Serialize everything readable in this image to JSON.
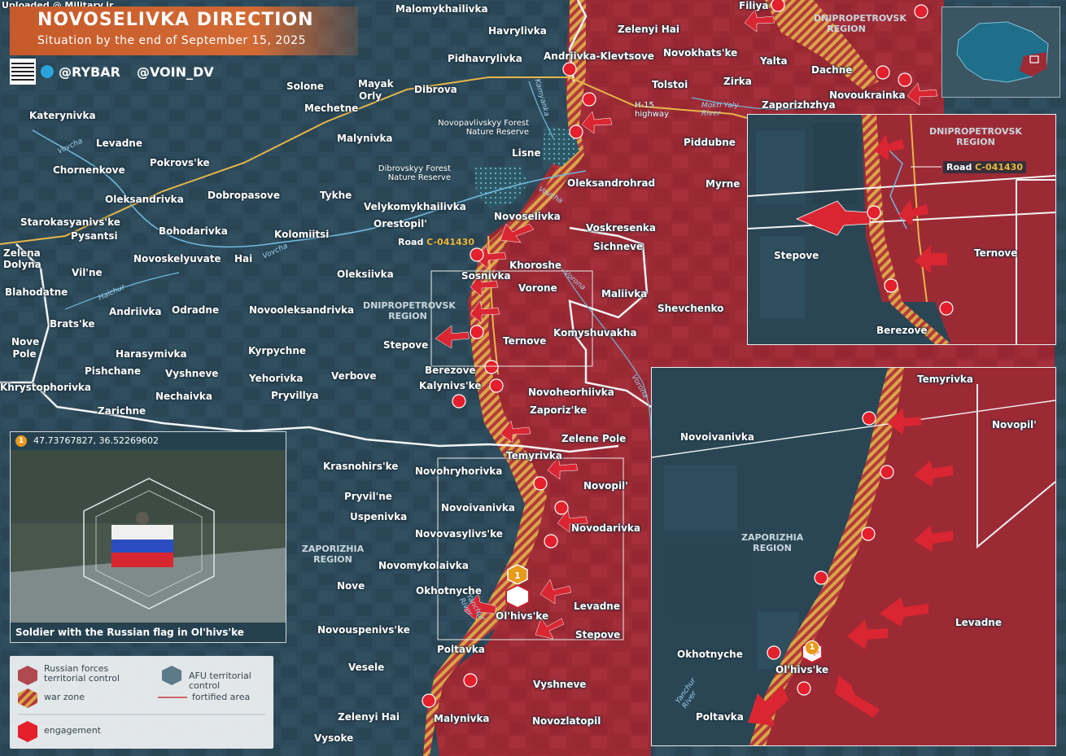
{
  "header": {
    "uploaded": "Uploaded @ Military.ir",
    "title": "NOVOSELIVKA DIRECTION",
    "subtitle": "Situation by the end of September 15, 2025",
    "handle_1": "@RYBAR",
    "handle_2": "@VOIN_DV"
  },
  "colors": {
    "afu_area": "#2c4b5c",
    "russian_area": "#9e2a35",
    "war_zone": "#d8a247",
    "engagement": "#c8202f",
    "accent": "#d36a34"
  },
  "settlements_afu": [
    "Malomykhailivka",
    "Havrylivka",
    "Pidhavrylivka",
    "Dibrova",
    "Mayak",
    "Orly",
    "Solone",
    "Mechetne",
    "Malynivka",
    "Katerynivka",
    "Levadne",
    "Chornenkove",
    "Pokrovs'ke",
    "Oleksandrivka",
    "Dobropasove",
    "Tykhe",
    "Velykomykhailivka",
    "Orestopil'",
    "Kolomiitsi",
    "Starokasyanivs'ke",
    "Pysantsi",
    "Bohodarivka",
    "Zelena Dolyna",
    "Novoskelyuvate",
    "Hai",
    "Vil'ne",
    "Oleksiivka",
    "Blahodatne",
    "Andriivka",
    "Odradne",
    "Novooleksandrivka",
    "Brats'ke",
    "Nove Pole",
    "Harasymivka",
    "Kyrpychne",
    "Pishchane",
    "Vyshneve",
    "Yehorivka",
    "Verbove",
    "Stepove",
    "Khrystophorivka",
    "Nechaivka",
    "Pryvillya",
    "Zarichne",
    "Krasnohirs'ke",
    "Novohryhorivka",
    "Pryvil'ne",
    "Uspenivka",
    "Novovasylivs'ke",
    "Novomykolaivka",
    "Nove",
    "Okhotnyche",
    "Novouspenivs'ke",
    "Poltavka",
    "Vesele",
    "Zelenyi Hai",
    "Vysoke",
    "Lisne",
    "Novoselivka",
    "Berezove",
    "Kalynivs'ke",
    "Novoivanivka"
  ],
  "settlements_ru": [
    "Filiya",
    "Zelenyi Hai",
    "Andriivka-Klevtsove",
    "Novokhats'ke",
    "Yalta",
    "Dachne",
    "Tolstoi",
    "Zirka",
    "Zaporizhzhya",
    "Novoukrainka",
    "Piddubne",
    "Oleksandrohrad",
    "Myrne",
    "Voskresenka",
    "Sichneve",
    "Khoroshe",
    "Sosnivka",
    "Vorone",
    "Maliivka",
    "Shevchenko",
    "Ternove",
    "Komyshuvakha",
    "Novoheorhiivka",
    "Zaporiz'ke",
    "Zelene Pole",
    "Temyrivka",
    "Novopil'",
    "Novodarivka",
    "Levadne",
    "Ol'hivs'ke",
    "Stepove",
    "Vyshneve",
    "Novozlatopil",
    "Malynivka"
  ],
  "regions": {
    "dnipro": "DNIPROPETROVSK REGION",
    "zaporizhia": "ZAPORIZHIA REGION"
  },
  "rivers": [
    "Vovcha",
    "Haichur",
    "Vorona",
    "Kamyanka",
    "Mokri Yaly River",
    "Yanchur River"
  ],
  "callouts": {
    "novopavlivskyy": "Novopavlivskyy Forest Nature Reserve",
    "dibrovskyy": "Dibrovskyy Forest Nature Reserve",
    "highway": "H-15 highway",
    "road_prefix": "Road ",
    "road_code": "C-041430"
  },
  "inset1": {
    "region": "DNIPROPETROVSK REGION",
    "road_prefix": "Road ",
    "road_code": "C-041430",
    "stepove": "Stepove",
    "ternove": "Ternove",
    "berezove": "Berezove"
  },
  "inset2": {
    "temyrivka": "Temyrivka",
    "novopil": "Novopil'",
    "novoivanivka": "Novoivanivka",
    "region": "ZAPORIZHIA REGION",
    "levadne": "Levadne",
    "okhotnyche": "Okhotnyche",
    "olhivske": "Ol'hivs'ke",
    "poltavka": "Poltavka",
    "river": "Yanchur River"
  },
  "photo": {
    "marker": "1",
    "coordinates": "47.73767827, 36.52269602",
    "caption": "Soldier with the Russian flag in Ol'hivs'ke"
  },
  "legend": {
    "russian": "Russian forces territorial control",
    "afu": "AFU territorial control",
    "war_zone": "war zone",
    "fortified": "fortified area",
    "engagement": "engagement"
  },
  "marker_label": "1",
  "watermark": "RYBAR"
}
